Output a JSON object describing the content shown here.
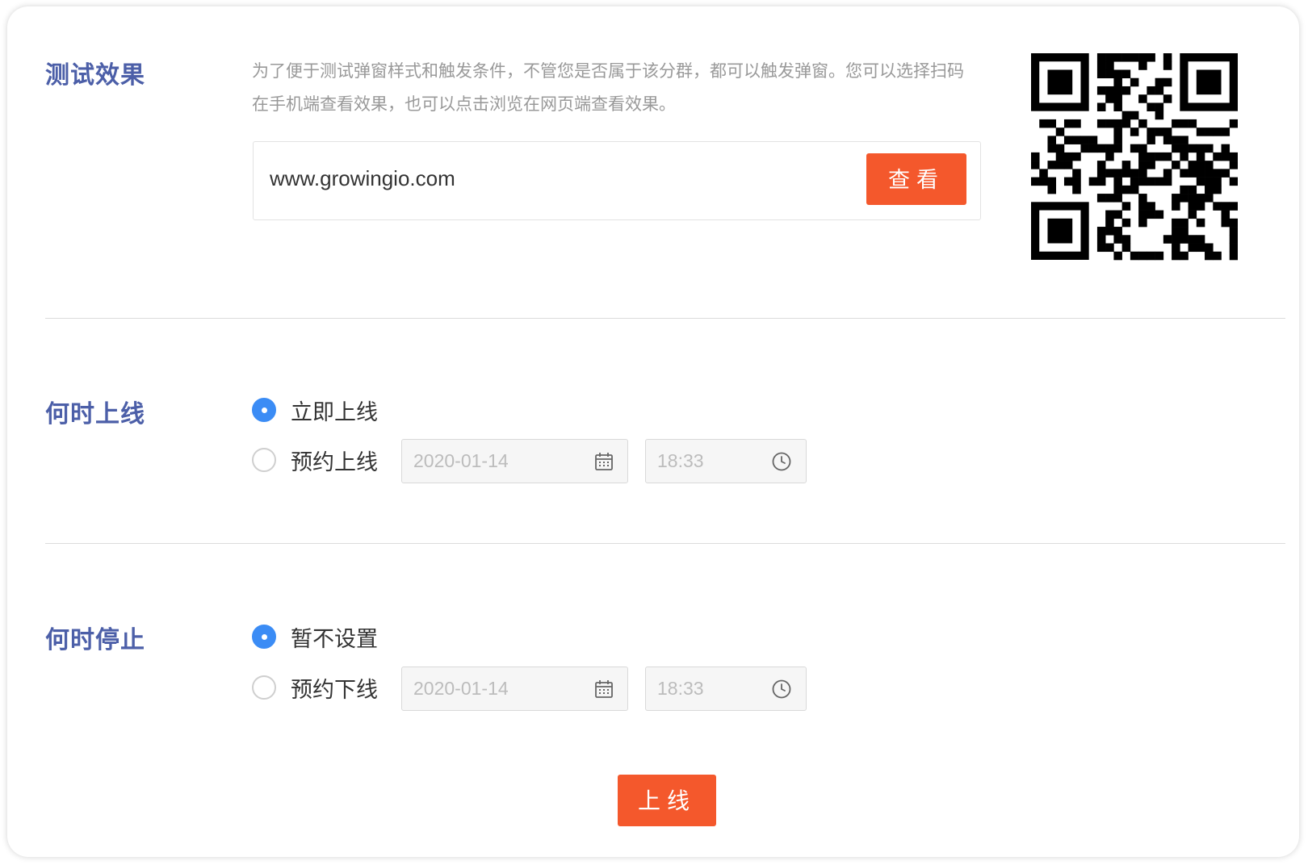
{
  "test_section": {
    "title": "测试效果",
    "description": "为了便于测试弹窗样式和触发条件，不管您是否属于该分群，都可以触发弹窗。您可以选择扫码在手机端查看效果，也可以点击浏览在网页端查看效果。",
    "url_value": "www.growingio.com",
    "view_button": "查看",
    "qr_icon": "qr-code"
  },
  "online_section": {
    "title": "何时上线",
    "options": [
      {
        "label": "立即上线",
        "checked": true
      },
      {
        "label": "预约上线",
        "checked": false
      }
    ],
    "date_placeholder": "2020-01-14",
    "time_placeholder": "18:33"
  },
  "stop_section": {
    "title": "何时停止",
    "options": [
      {
        "label": "暂不设置",
        "checked": true
      },
      {
        "label": "预约下线",
        "checked": false
      }
    ],
    "date_placeholder": "2020-01-14",
    "time_placeholder": "18:33"
  },
  "submit_button": "上线",
  "colors": {
    "title": "#4c5fa8",
    "accent_orange": "#f4582c",
    "radio_blue": "#3b8cf5"
  }
}
